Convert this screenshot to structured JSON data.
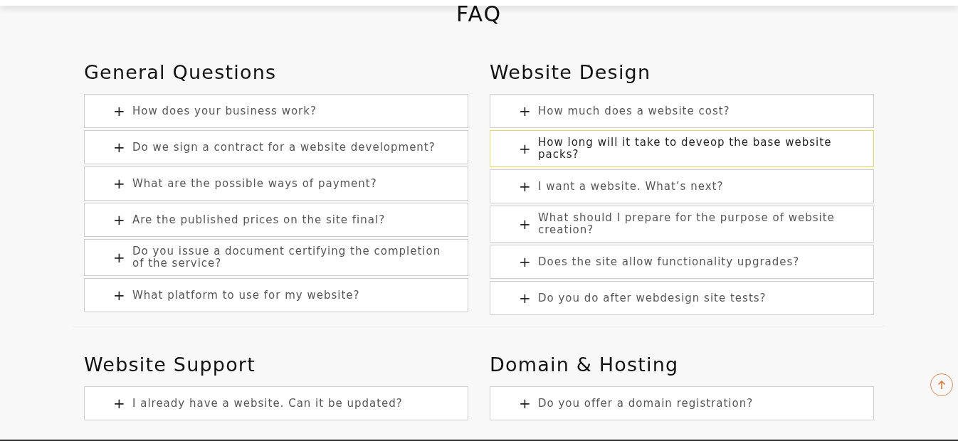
{
  "title": "FAQ",
  "sections": [
    {
      "heading": "General Questions",
      "items": [
        {
          "icon": "+",
          "question": "How does your business work?",
          "highlighted": false
        },
        {
          "icon": "+",
          "question": "Do we sign a contract for a website development?",
          "highlighted": false
        },
        {
          "icon": "+",
          "question": "What are the possible ways of payment?",
          "highlighted": false
        },
        {
          "icon": "+",
          "question": "Are the published prices on the site final?",
          "highlighted": false
        },
        {
          "icon": "+",
          "question": "Do you issue a document certifying the completion of the service?",
          "highlighted": false
        },
        {
          "icon": "+",
          "question": "What platform to use for my website?",
          "highlighted": false
        }
      ]
    },
    {
      "heading": "Website Design",
      "items": [
        {
          "icon": "+",
          "question": "How much does a website cost?",
          "highlighted": false
        },
        {
          "icon": "+",
          "question": "How long will it take to deveop the base website packs?",
          "highlighted": true
        },
        {
          "icon": "+",
          "question": "I want a website. What’s next?",
          "highlighted": false
        },
        {
          "icon": "+",
          "question": "What should I prepare for the purpose of website creation?",
          "highlighted": false
        },
        {
          "icon": "+",
          "question": "Does the site allow functionality upgrades?",
          "highlighted": false
        },
        {
          "icon": "+",
          "question": "Do you do after webdesign site tests?",
          "highlighted": false
        }
      ]
    },
    {
      "heading": "Website Support",
      "items": [
        {
          "icon": "+",
          "question": "I already have a website. Can it be updated?",
          "highlighted": false
        }
      ]
    },
    {
      "heading": "Domain & Hosting",
      "items": [
        {
          "icon": "+",
          "question": "Do you offer a domain registration?",
          "highlighted": false
        }
      ]
    }
  ]
}
